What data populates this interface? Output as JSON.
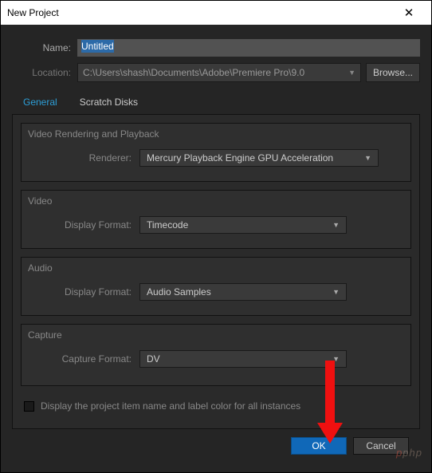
{
  "window": {
    "title": "New Project"
  },
  "name": {
    "label": "Name:",
    "value": "Untitled"
  },
  "location": {
    "label": "Location:",
    "path": "C:\\Users\\shash\\Documents\\Adobe\\Premiere Pro\\9.0",
    "browse": "Browse..."
  },
  "tabs": {
    "general": "General",
    "scratch": "Scratch Disks"
  },
  "sections": {
    "rendering": {
      "title": "Video Rendering and Playback",
      "renderer_label": "Renderer:",
      "renderer_value": "Mercury Playback Engine GPU Acceleration"
    },
    "video": {
      "title": "Video",
      "format_label": "Display Format:",
      "format_value": "Timecode"
    },
    "audio": {
      "title": "Audio",
      "format_label": "Display Format:",
      "format_value": "Audio Samples"
    },
    "capture": {
      "title": "Capture",
      "format_label": "Capture Format:",
      "format_value": "DV"
    }
  },
  "checkbox": {
    "label": "Display the project item name and label color for all instances"
  },
  "buttons": {
    "ok": "OK",
    "cancel": "Cancel"
  },
  "watermark": "php"
}
